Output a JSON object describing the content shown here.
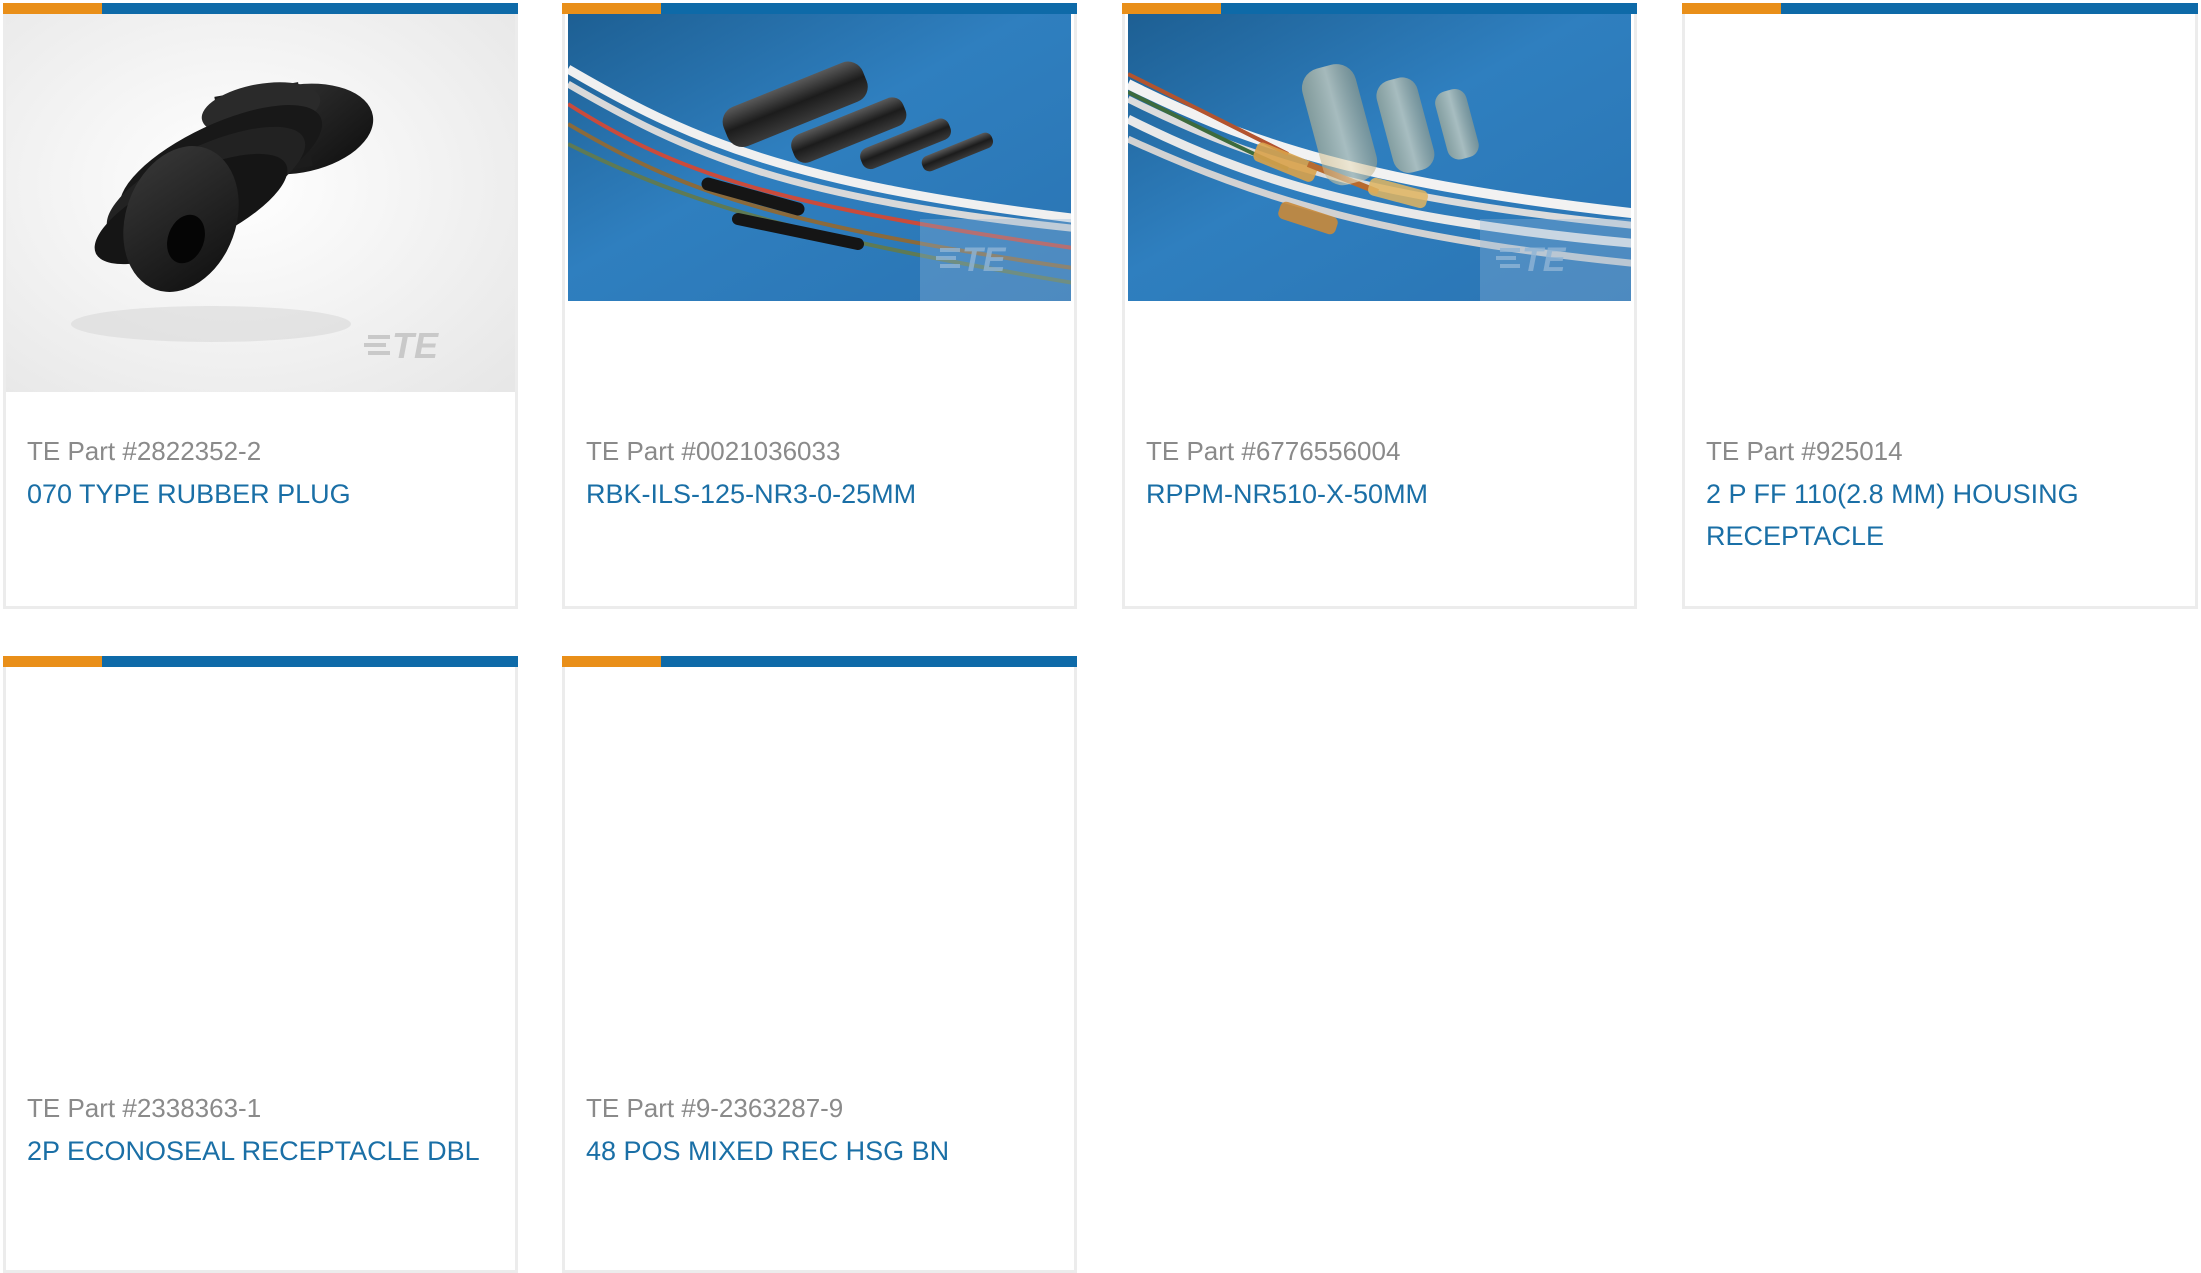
{
  "products": [
    {
      "part_number": "TE Part #2822352-2",
      "title": "070 TYPE RUBBER PLUG",
      "image": "rubber-plug-photo"
    },
    {
      "part_number": "TE Part #0021036033",
      "title": "RBK-ILS-125-NR3-0-25MM",
      "image": "heat-shrink-tubing-photo"
    },
    {
      "part_number": "TE Part #6776556004",
      "title": "RPPM-NR510-X-50MM",
      "image": "solder-sleeve-photo"
    },
    {
      "part_number": "TE Part #925014",
      "title": "2 P FF 110(2.8 MM) HOUSING RECEPTACLE",
      "image": ""
    },
    {
      "part_number": "TE Part #2338363-1",
      "title": "2P ECONOSEAL RECEPTACLE DBL",
      "image": ""
    },
    {
      "part_number": "TE Part #9-2363287-9",
      "title": "48 POS MIXED REC HSG BN",
      "image": ""
    }
  ],
  "brand": {
    "logo_text": "TE",
    "accent_color": "#e98f19",
    "bar_color": "#0e6aa8",
    "link_color": "#1a6fa6",
    "muted_text_color": "#8a8a8a"
  }
}
